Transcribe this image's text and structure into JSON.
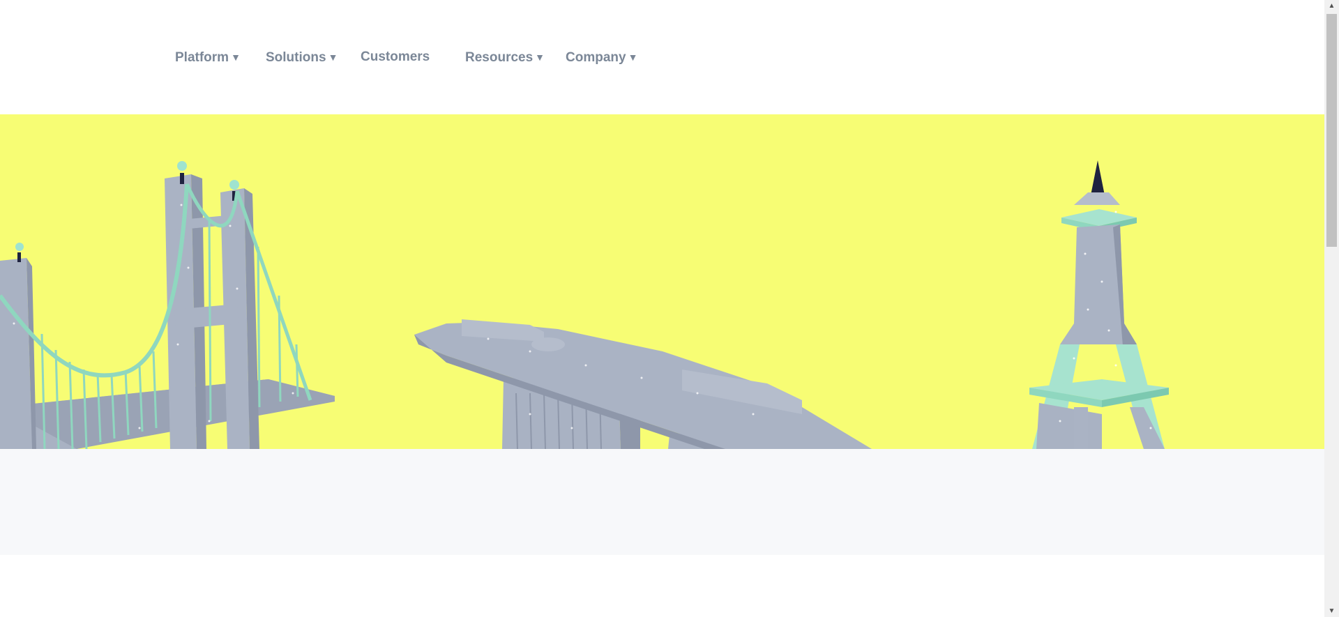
{
  "nav": {
    "items": [
      {
        "label": "Platform",
        "caret": "▼"
      },
      {
        "label": "Solutions",
        "caret": "▼"
      },
      {
        "label": "Customers"
      },
      {
        "label": "Resources",
        "caret": "▼"
      },
      {
        "label": "Company",
        "caret": "▼"
      }
    ]
  },
  "hero": {
    "background": "#f7fd74",
    "illustrations": [
      "suspension-bridge",
      "marina-bay-sands",
      "eiffel-tower"
    ]
  },
  "colors": {
    "nav_text": "#7b8797",
    "building_grey": "#a9b2c3",
    "mint": "#a7e3cf",
    "band_grey": "#f7f8fa"
  },
  "scrollbar": {
    "up_glyph": "▲",
    "down_glyph": "▼"
  }
}
